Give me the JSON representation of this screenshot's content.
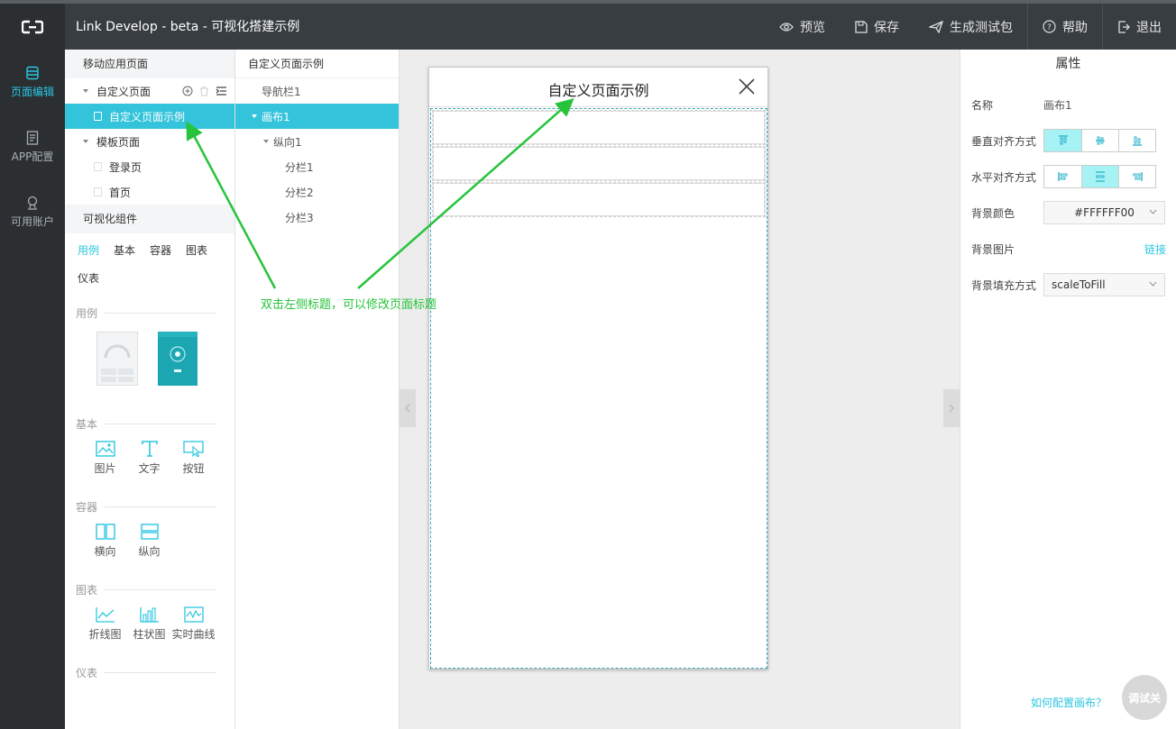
{
  "header": {
    "app_title": "Link Develop - beta - 可视化搭建示例",
    "nav": [
      {
        "label": "预览",
        "icon": "eye-icon"
      },
      {
        "label": "保存",
        "icon": "save-icon"
      },
      {
        "label": "生成测试包",
        "icon": "send-icon"
      },
      {
        "label": "帮助",
        "icon": "help-icon"
      },
      {
        "label": "退出",
        "icon": "logout-icon"
      }
    ]
  },
  "rail": {
    "items": [
      {
        "label": "页面编辑",
        "icon": "database-icon",
        "active": true
      },
      {
        "label": "APP配置",
        "icon": "document-icon"
      },
      {
        "label": "可用账户",
        "icon": "user-icon"
      }
    ]
  },
  "pages_panel": {
    "title": "移动应用页面",
    "custom_group": "自定义页面",
    "custom_pages": [
      "自定义页面示例"
    ],
    "template_group": "模板页面",
    "template_pages": [
      "登录页",
      "首页"
    ]
  },
  "components": {
    "title": "可视化组件",
    "tabs": [
      "用例",
      "基本",
      "容器",
      "图表",
      "仪表"
    ],
    "active_tab": "用例",
    "groups": {
      "examples": "用例",
      "basic": {
        "title": "基本",
        "items": [
          "图片",
          "文字",
          "按钮"
        ]
      },
      "container": {
        "title": "容器",
        "items": [
          "横向",
          "纵向"
        ]
      },
      "chart": {
        "title": "图表",
        "items": [
          "折线图",
          "柱状图",
          "实时曲线"
        ]
      },
      "gauge": {
        "title": "仪表"
      }
    }
  },
  "outline": {
    "title": "自定义页面示例",
    "items": [
      {
        "label": "导航栏1",
        "level": 1
      },
      {
        "label": "画布1",
        "level": 1,
        "selected": true
      },
      {
        "label": "纵向1",
        "level": 2
      },
      {
        "label": "分栏1",
        "level": 3
      },
      {
        "label": "分栏2",
        "level": 3
      },
      {
        "label": "分栏3",
        "level": 3
      }
    ]
  },
  "canvas": {
    "page_title": "自定义页面示例"
  },
  "annotation": "双击左侧标题，可以修改页面标题",
  "properties": {
    "title": "属性",
    "name_label": "名称",
    "name_value": "画布1",
    "valign_label": "垂直对齐方式",
    "halign_label": "水平对齐方式",
    "bg_color_label": "背景颜色",
    "bg_color_value": "#FFFFFF00",
    "bg_image_label": "背景图片",
    "bg_image_link": "链接",
    "bg_fill_label": "背景填充方式",
    "bg_fill_value": "scaleToFill",
    "help_link": "如何配置画布？",
    "debug_button": "调试关"
  },
  "colors": {
    "accent": "#33c3da",
    "topbar": "#373d41",
    "rail": "#2b2f32",
    "annotation": "#27c43b"
  }
}
